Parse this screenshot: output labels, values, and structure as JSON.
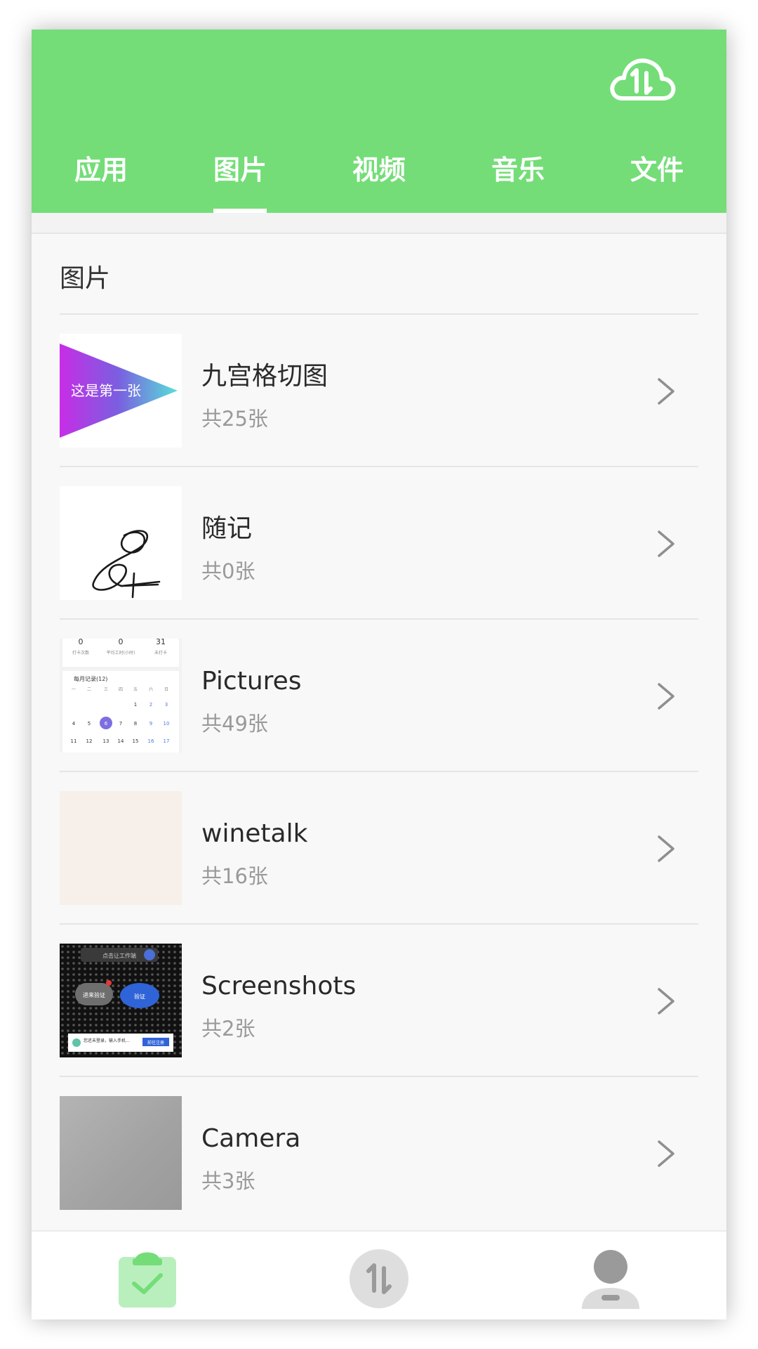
{
  "header": {
    "background_color": "#74dd78",
    "sync_icon": "cloud-transfer-icon",
    "tabs": [
      {
        "label": "应用",
        "active": false
      },
      {
        "label": "图片",
        "active": true
      },
      {
        "label": "视频",
        "active": false
      },
      {
        "label": "音乐",
        "active": false
      },
      {
        "label": "文件",
        "active": false
      }
    ]
  },
  "section": {
    "title": "图片"
  },
  "albums": [
    {
      "name": "九宫格切图",
      "count": "共25张",
      "thumb_text": "这是第一张"
    },
    {
      "name": "随记",
      "count": "共0张"
    },
    {
      "name": "Pictures",
      "count": "共49张",
      "thumb_calendar": {
        "stats": [
          "0",
          "0",
          "31"
        ],
        "stat_labels": [
          "打卡次数",
          "平均工时(小时)",
          "未打卡"
        ],
        "title": "每月记录(12)",
        "weekdays": [
          "一",
          "二",
          "三",
          "四",
          "五",
          "六",
          "日"
        ],
        "row1": [
          "",
          "",
          "",
          "",
          "1",
          "2",
          "3"
        ],
        "row2": [
          "4",
          "5",
          "6",
          "7",
          "8",
          "9",
          "10"
        ],
        "row3": [
          "11",
          "12",
          "13",
          "14",
          "15",
          "16",
          "17"
        ]
      }
    },
    {
      "name": "winetalk",
      "count": "共16张"
    },
    {
      "name": "Screenshots",
      "count": "共2张",
      "thumb_texts": [
        "点击让工作端",
        "进来验证",
        "验证",
        "您还未登录，输入手机...",
        "前往注册"
      ]
    },
    {
      "name": "Camera",
      "count": "共3张"
    }
  ],
  "bottom_nav": {
    "items": [
      {
        "icon": "clipboard-check-icon",
        "active": true
      },
      {
        "icon": "transfer-icon",
        "active": false
      },
      {
        "icon": "user-profile-icon",
        "active": false
      }
    ],
    "active_color": "#74dd78",
    "inactive_color": "#9a9a9a"
  }
}
